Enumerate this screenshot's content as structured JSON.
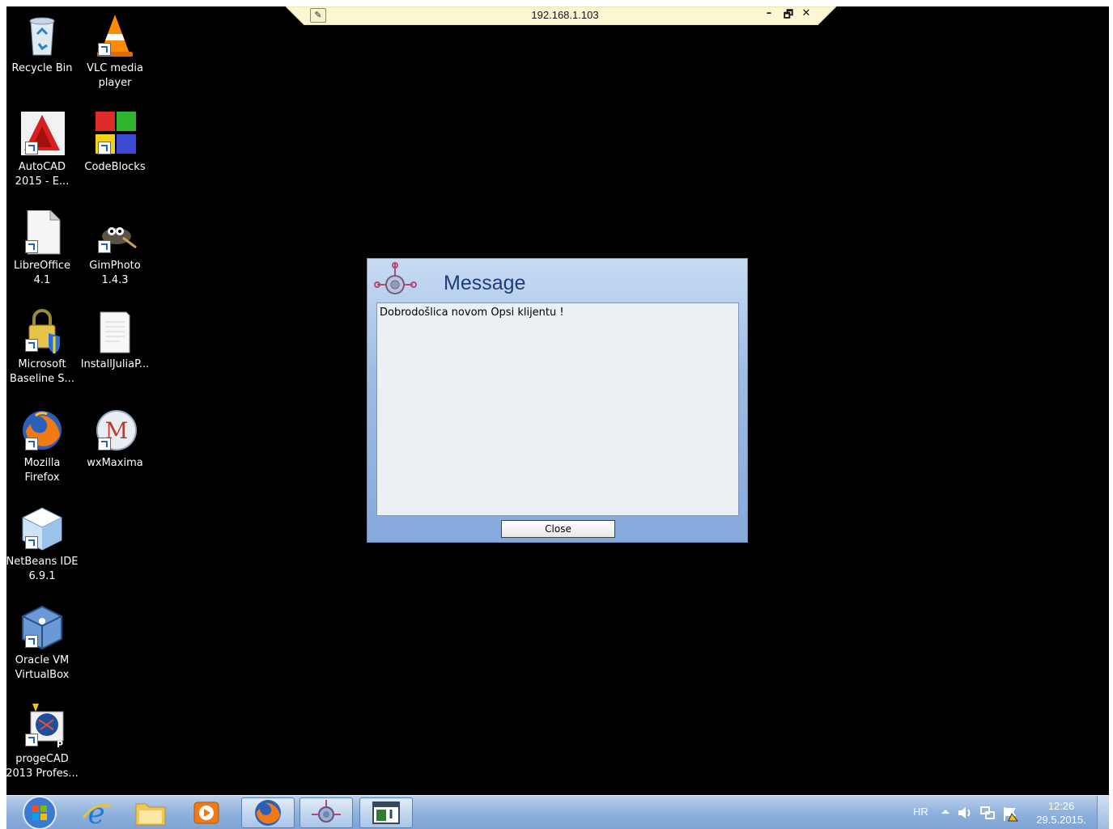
{
  "remote_bar": {
    "address": "192.168.1.103",
    "pin_icon": "pin-icon",
    "minimize_label": "–",
    "restore_label": "🗗",
    "close_label": "✕"
  },
  "desktop_icons": [
    {
      "label": "Recycle Bin",
      "icon": "recycle-bin-icon"
    },
    {
      "label": "VLC media\nplayer",
      "icon": "vlc-icon"
    },
    {
      "label": "AutoCAD\n2015 - E...",
      "icon": "autocad-icon"
    },
    {
      "label": "CodeBlocks",
      "icon": "codeblocks-icon"
    },
    {
      "label": "LibreOffice\n4.1",
      "icon": "libreoffice-icon"
    },
    {
      "label": "GimPhoto\n1.4.3",
      "icon": "gimphoto-icon"
    },
    {
      "label": "Microsoft\nBaseline S...",
      "icon": "mbsa-icon"
    },
    {
      "label": "InstallJuliaP...",
      "icon": "document-icon"
    },
    {
      "label": "Mozilla\nFirefox",
      "icon": "firefox-icon"
    },
    {
      "label": "wxMaxima",
      "icon": "wxmaxima-icon"
    },
    {
      "label": "NetBeans IDE\n6.9.1",
      "icon": "netbeans-icon"
    },
    {
      "label": "Oracle VM\nVirtualBox",
      "icon": "virtualbox-icon"
    },
    {
      "label": "progeCAD\n2013 Profes...",
      "icon": "progecad-icon"
    }
  ],
  "dialog": {
    "title": "Message",
    "message": "Dobrodošlica novom Opsi klijentu !",
    "close_label": "Close",
    "logo_icon": "opsi-logo-icon"
  },
  "taskbar": {
    "items": [
      {
        "name": "start-button",
        "icon": "windows-start-icon"
      },
      {
        "name": "internet-explorer",
        "icon": "internet-explorer-icon"
      },
      {
        "name": "file-explorer",
        "icon": "folder-icon"
      },
      {
        "name": "media-player",
        "icon": "media-player-icon"
      },
      {
        "name": "firefox",
        "icon": "firefox-icon",
        "active": true
      },
      {
        "name": "opsi",
        "icon": "opsi-icon",
        "active": true
      },
      {
        "name": "window",
        "icon": "window-icon",
        "active": true
      }
    ],
    "tray": {
      "language": "HR",
      "time": "12:26",
      "date": "29.5.2015."
    }
  }
}
